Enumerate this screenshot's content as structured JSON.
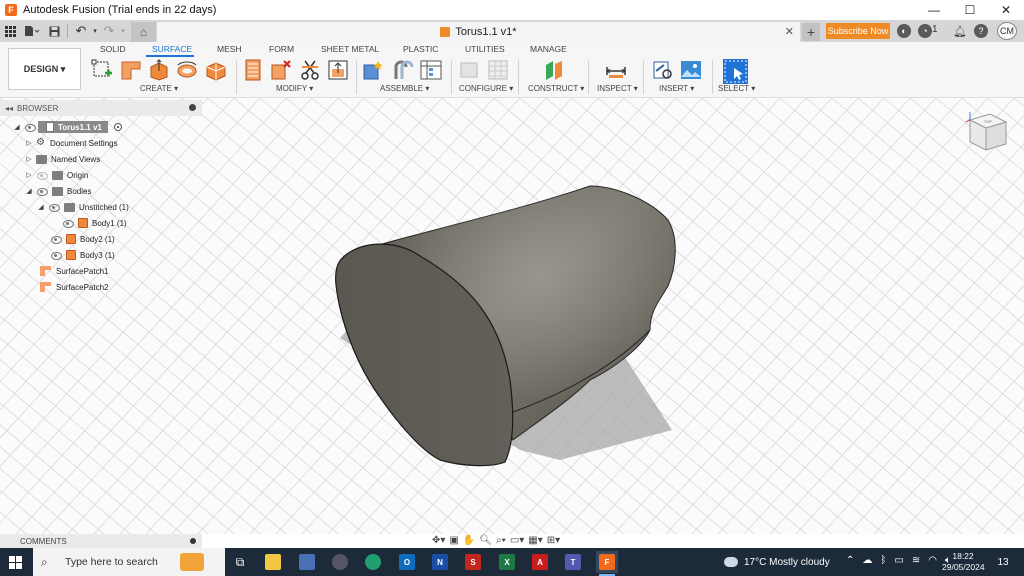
{
  "window": {
    "title": "Autodesk Fusion (Trial ends in 22 days)",
    "minimize": "—",
    "maximize": "☐",
    "close": "✕"
  },
  "tabbar": {
    "doc_title": "Torus1.1 v1*",
    "tab_close": "✕",
    "new_tab": "+",
    "subscribe_label": "Subscribe Now",
    "job_count": "1",
    "user_initials": "CM"
  },
  "toolbar": {
    "workspace_label": "DESIGN ▾",
    "tabs": [
      "SOLID",
      "SURFACE",
      "MESH",
      "FORM",
      "SHEET METAL",
      "PLASTIC",
      "UTILITIES",
      "MANAGE"
    ],
    "active_tab": "SURFACE",
    "groups": [
      "CREATE ▾",
      "MODIFY ▾",
      "ASSEMBLE ▾",
      "CONFIGURE ▾",
      "CONSTRUCT ▾",
      "INSPECT ▾",
      "INSERT ▾",
      "SELECT ▾"
    ]
  },
  "browser": {
    "title": "BROWSER",
    "root": "Torus1.1 v1",
    "items": {
      "doc_settings": "Document Settings",
      "named_views": "Named Views",
      "origin": "Origin",
      "bodies": "Bodies",
      "unstitched": "Unstitched (1)",
      "body1": "Body1 (1)",
      "body2": "Body2 (1)",
      "body3": "Body3 (1)",
      "patch1": "SurfacePatch1",
      "patch2": "SurfacePatch2"
    }
  },
  "viewcube": {
    "face_label": "TOP"
  },
  "comments": {
    "label": "COMMENTS"
  },
  "taskbar": {
    "search_placeholder": "Type here to search",
    "weather": "17°C  Mostly cloudy",
    "time": "18:22",
    "date": "29/05/2024",
    "notifications": "13"
  },
  "colors": {
    "accent": "#1f73d6",
    "brand_orange": "#f08a24",
    "model_body": "#6e6b63",
    "taskbar": "#1c2a3a"
  }
}
